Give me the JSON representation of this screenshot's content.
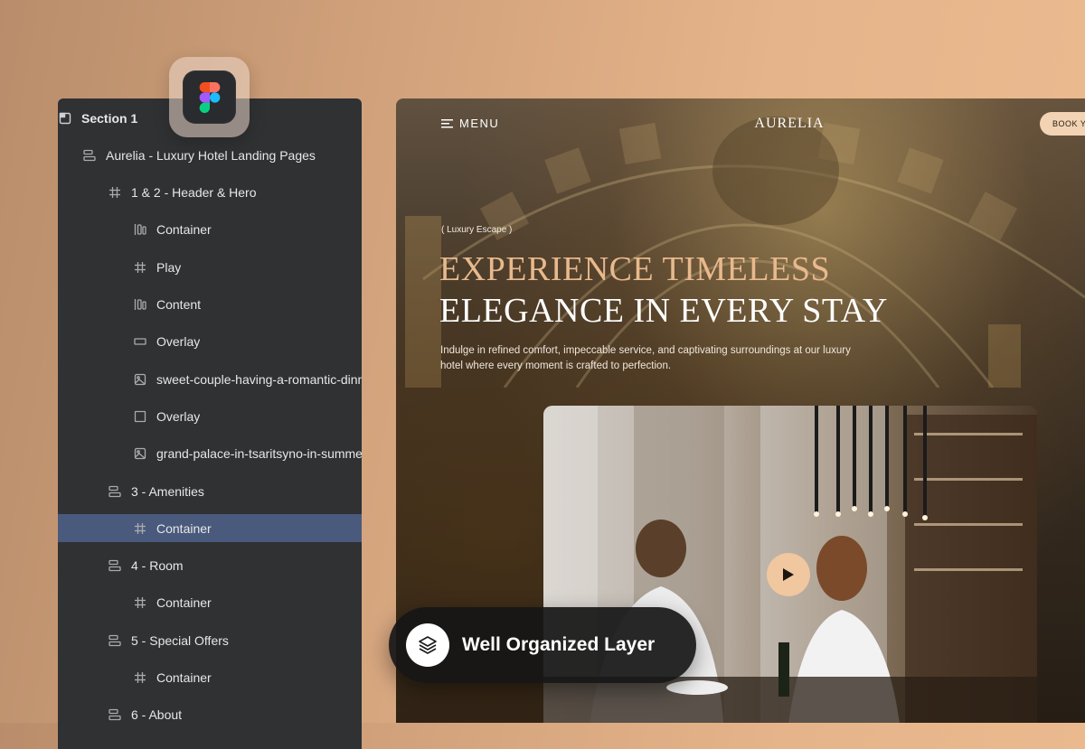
{
  "layers": {
    "rows": [
      {
        "label": "Section 1",
        "icon": "section-icon",
        "indent": 0,
        "selected": false,
        "bold": true
      },
      {
        "label": "Aurelia - Luxury Hotel Landing Pages",
        "icon": "auto-layout-icon",
        "indent": 1,
        "selected": false,
        "bold": false
      },
      {
        "label": "1 & 2 - Header & Hero",
        "icon": "frame-icon",
        "indent": 2,
        "selected": false,
        "bold": false
      },
      {
        "label": "Container",
        "icon": "auto-layout-horizontal-icon",
        "indent": 3,
        "selected": false,
        "bold": false
      },
      {
        "label": "Play",
        "icon": "frame-icon",
        "indent": 3,
        "selected": false,
        "bold": false
      },
      {
        "label": "Content",
        "icon": "auto-layout-horizontal-icon",
        "indent": 3,
        "selected": false,
        "bold": false
      },
      {
        "label": "Overlay",
        "icon": "rectangle-icon",
        "indent": 3,
        "selected": false,
        "bold": false
      },
      {
        "label": "sweet-couple-having-a-romantic-dinner",
        "icon": "image-icon",
        "indent": 3,
        "selected": false,
        "bold": false
      },
      {
        "label": "Overlay",
        "icon": "square-icon",
        "indent": 3,
        "selected": false,
        "bold": false
      },
      {
        "label": "grand-palace-in-tsaritsyno-in-summer",
        "icon": "image-icon",
        "indent": 3,
        "selected": false,
        "bold": false
      },
      {
        "label": "3 - Amenities",
        "icon": "auto-layout-icon",
        "indent": 2,
        "selected": false,
        "bold": false
      },
      {
        "label": "Container",
        "icon": "frame-icon",
        "indent": 3,
        "selected": true,
        "bold": false
      },
      {
        "label": "4 - Room",
        "icon": "auto-layout-icon",
        "indent": 2,
        "selected": false,
        "bold": false
      },
      {
        "label": "Container",
        "icon": "frame-icon",
        "indent": 3,
        "selected": false,
        "bold": false
      },
      {
        "label": "5 - Special Offers",
        "icon": "auto-layout-icon",
        "indent": 2,
        "selected": false,
        "bold": false
      },
      {
        "label": "Container",
        "icon": "frame-icon",
        "indent": 3,
        "selected": false,
        "bold": false
      },
      {
        "label": "6 - About",
        "icon": "auto-layout-icon",
        "indent": 2,
        "selected": false,
        "bold": false
      }
    ]
  },
  "badge": {
    "icon": "figma-logo-icon"
  },
  "hero": {
    "menu_label": "MENU",
    "brand": "AURELIA",
    "book_label": "BOOK Y",
    "eyebrow": "( Luxury Escape )",
    "headline_line1": "EXPERIENCE TIMELESS",
    "headline_line2": "ELEGANCE IN EVERY STAY",
    "description": "Indulge in refined comfort, impeccable service, and captivating surroundings at our luxury hotel where every moment is crafted to perfection."
  },
  "pill": {
    "label": "Well Organized Layer",
    "icon": "layers-icon"
  },
  "colors": {
    "accent": "#e8b98d",
    "panel": "#2f3133",
    "selected_row": "#4a5a7d",
    "play": "#f0c79f"
  }
}
